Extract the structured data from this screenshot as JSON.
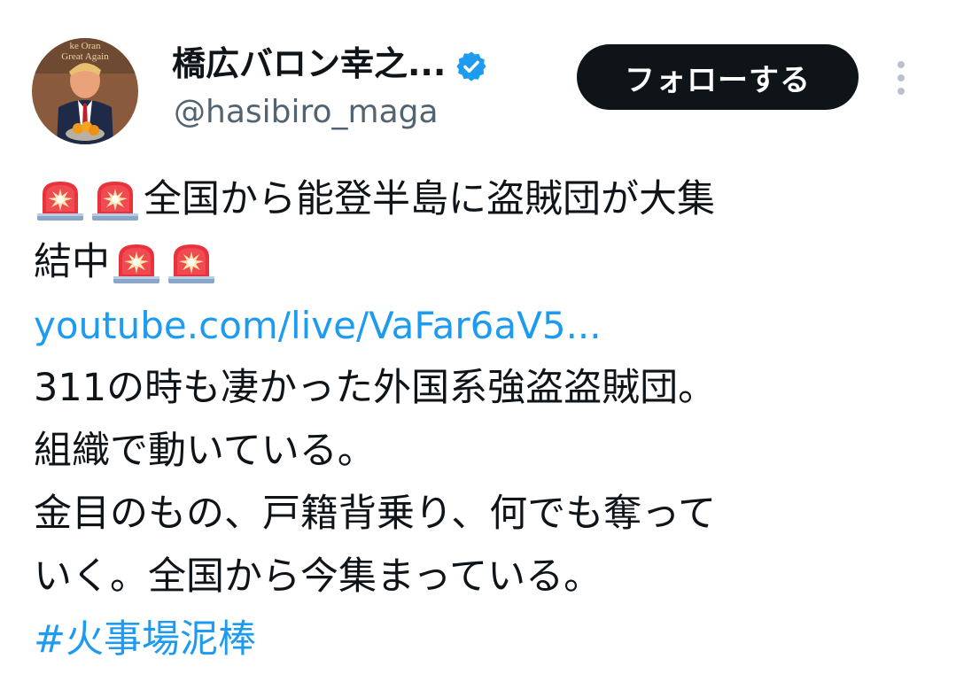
{
  "author": {
    "display_name": "橋広バロン幸之...",
    "handle": "@hasibiro_maga",
    "verified_icon": "verified-badge-icon",
    "avatar_text_line1": "ke Oran",
    "avatar_text_line2": "Great Again"
  },
  "follow_button": {
    "label": "フォローする"
  },
  "more_menu_icon": "more-vertical-icon",
  "tweet": {
    "line1_text": "全国から能登半島に盗賊団が大集",
    "line2_text": "結中",
    "link_text": "youtube.com/live/VaFar6aV5...",
    "line4_text": "311の時も凄かった外国系強盗盗賊団。",
    "line5_text": "組織で動いている。",
    "line6_text": "金目のもの、戸籍背乗り、何でも奪って",
    "line7_text": "いく。全国から今集まっている。",
    "hashtag_text": "#火事場泥棒",
    "emoji_name": "police-car-light-emoji"
  },
  "colors": {
    "link": "#1d9bf0",
    "button_bg": "#0f1419",
    "secondary_text": "#536471"
  }
}
